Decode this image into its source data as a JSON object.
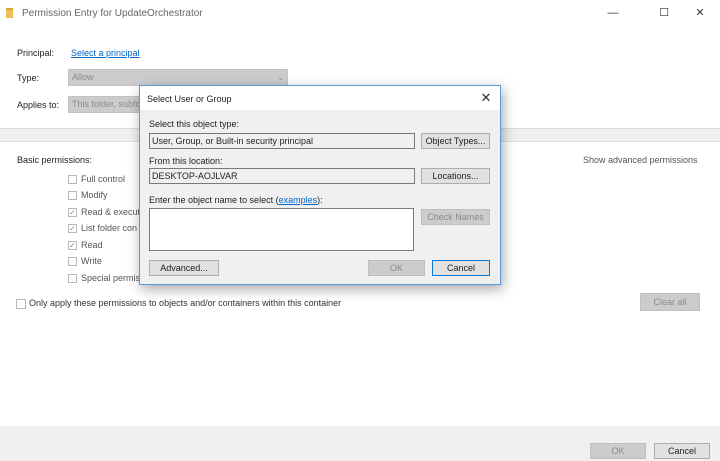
{
  "window": {
    "title": "Permission Entry for UpdateOrchestrator",
    "controls": {
      "minimize": "—",
      "maximize": "☐",
      "close": "✕"
    }
  },
  "principal": {
    "label": "Principal:",
    "link": "Select a principal"
  },
  "type": {
    "label": "Type:",
    "value": "Allow"
  },
  "applies_to": {
    "label": "Applies to:",
    "value": "This folder, subfo"
  },
  "basic_permissions": {
    "label": "Basic permissions:",
    "show_advanced": "Show advanced permissions",
    "items": [
      {
        "label": "Full control",
        "checked": false
      },
      {
        "label": "Modify",
        "checked": false
      },
      {
        "label": "Read & execut",
        "checked": true
      },
      {
        "label": "List folder con",
        "checked": true
      },
      {
        "label": "Read",
        "checked": true
      },
      {
        "label": "Write",
        "checked": false
      },
      {
        "label": "Special permis",
        "checked": false
      }
    ],
    "only_apply_label": "Only apply these permissions to objects and/or containers within this container",
    "clear_all": "Clear all"
  },
  "footer": {
    "ok": "OK",
    "cancel": "Cancel"
  },
  "dialog": {
    "title": "Select User or Group",
    "close": "✕",
    "object_type_label": "Select this object type:",
    "object_type_value": "User, Group, or Built-in security principal",
    "object_types_button": "Object Types...",
    "location_label": "From this location:",
    "location_value": "DESKTOP-AOJLVAR",
    "locations_button": "Locations...",
    "enter_name_label_pre": "Enter the object name to select (",
    "examples_link": "examples",
    "enter_name_label_post": "):",
    "object_name_value": "",
    "check_names_button": "Check Names",
    "advanced_button": "Advanced...",
    "ok_button": "OK",
    "cancel_button": "Cancel"
  }
}
